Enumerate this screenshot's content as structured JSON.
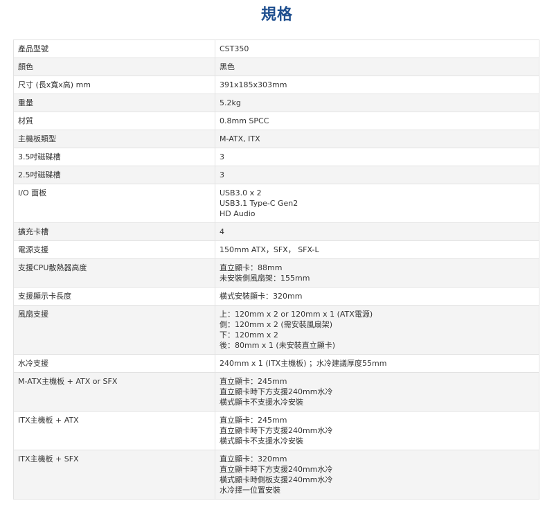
{
  "title": "規格",
  "rows": [
    {
      "label": "產品型號",
      "lines": [
        "CST350"
      ]
    },
    {
      "label": "顏色",
      "lines": [
        "黑色"
      ]
    },
    {
      "label": "尺寸 (長x寬x高) mm",
      "lines": [
        "391x185x303mm"
      ]
    },
    {
      "label": "重量",
      "lines": [
        "5.2kg"
      ]
    },
    {
      "label": "材質",
      "lines": [
        "0.8mm SPCC"
      ]
    },
    {
      "label": "主機板類型",
      "lines": [
        "M-ATX, ITX"
      ]
    },
    {
      "label": "3.5吋磁碟槽",
      "lines": [
        "3"
      ]
    },
    {
      "label": "2.5吋磁碟槽",
      "lines": [
        "3"
      ]
    },
    {
      "label": "I/O 面板",
      "lines": [
        "USB3.0 x 2",
        "USB3.1 Type-C Gen2",
        "HD Audio"
      ]
    },
    {
      "label": "擴充卡槽",
      "lines": [
        "4"
      ]
    },
    {
      "label": "電源支援",
      "lines": [
        "150mm ATX，SFX， SFX-L"
      ]
    },
    {
      "label": "支援CPU散熱器高度",
      "lines": [
        "直立顯卡：88mm",
        "未安裝側風扇架：155mm"
      ]
    },
    {
      "label": "支援顯示卡長度",
      "lines": [
        "橫式安裝顯卡：320mm"
      ]
    },
    {
      "label": "風扇支援",
      "lines": [
        "上：120mm x 2 or 120mm x 1 (ATX電源)",
        "側：120mm x 2 (需安裝風扇架)",
        "下：120mm x 2",
        "後：80mm x 1 (未安裝直立顯卡)"
      ]
    },
    {
      "label": "水冷支援",
      "lines": [
        "240mm x 1 (ITX主機板) ；水冷建議厚度55mm"
      ]
    },
    {
      "label": "M-ATX主機板 + ATX or SFX",
      "lines": [
        "直立顯卡：245mm",
        "直立顯卡時下方支援240mm水冷",
        "橫式顯卡不支援水冷安裝"
      ]
    },
    {
      "label": "ITX主機板 + ATX",
      "lines": [
        "直立顯卡：245mm",
        "直立顯卡時下方支援240mm水冷",
        "橫式顯卡不支援水冷安裝"
      ]
    },
    {
      "label": "ITX主機板 + SFX",
      "lines": [
        "直立顯卡：320mm",
        "直立顯卡時下方支援240mm水冷",
        "橫式顯卡時側板支援240mm水冷",
        "水冷擇一位置安裝"
      ]
    }
  ]
}
